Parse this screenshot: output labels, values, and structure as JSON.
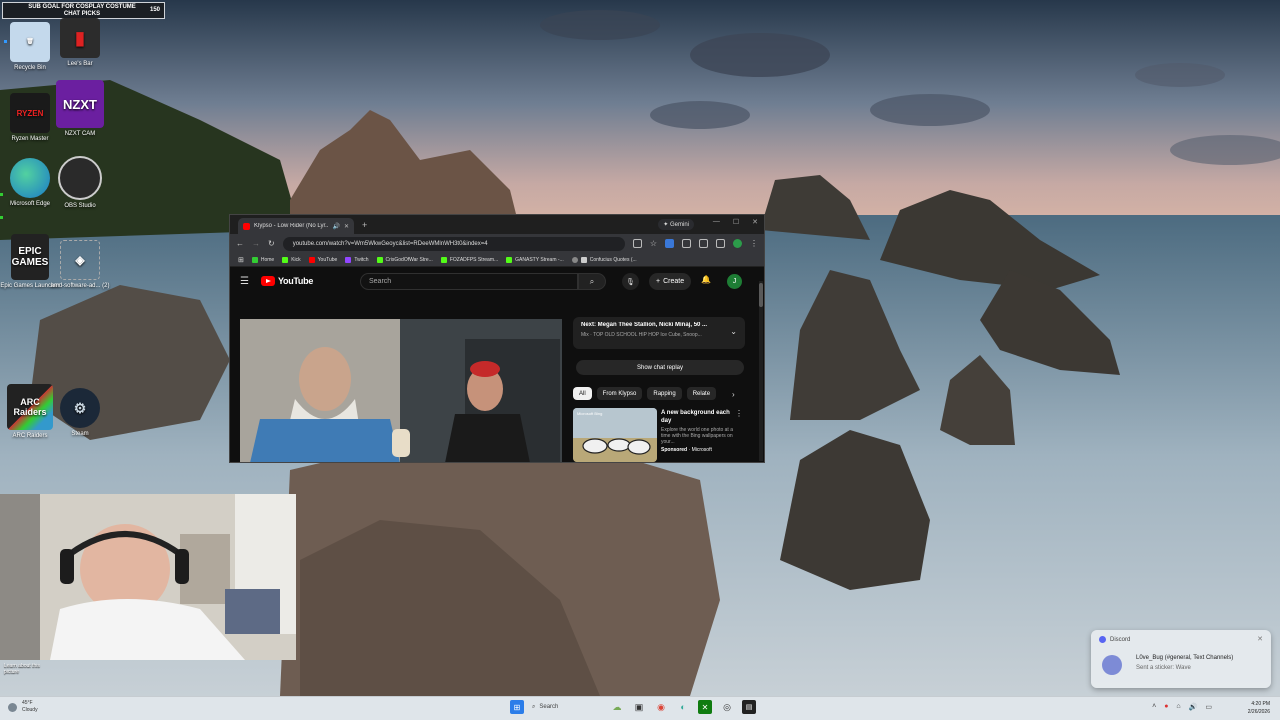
{
  "overlay": {
    "sub_goal_line1": "SUB GOAL FOR COSPLAY COSTUME",
    "sub_goal_line2": "CHAT PICKS",
    "sub_goal_count": "150"
  },
  "desktop_icons": [
    {
      "label": "Recycle Bin",
      "name": "recycle-bin"
    },
    {
      "label": "Lee's Bar",
      "name": "lees-bar"
    },
    {
      "label": "Ryzen Master",
      "name": "ryzen-master"
    },
    {
      "label": "NZXT CAM",
      "name": "nzxt-cam"
    },
    {
      "label": "Microsoft Edge",
      "name": "microsoft-edge"
    },
    {
      "label": "OBS Studio",
      "name": "obs-studio"
    },
    {
      "label": "Epic Games Launcher",
      "name": "epic-games-launcher"
    },
    {
      "label": "amd-software-ad... (2)",
      "name": "amd-software"
    },
    {
      "label": "ARC Raiders",
      "name": "arc-raiders"
    },
    {
      "label": "Steam",
      "name": "steam"
    }
  ],
  "icon_tiles": {
    "epic": "EPIC\nGAMES",
    "nzxt": "NZXT",
    "arc": "ARC\nRaiders"
  },
  "browser": {
    "tab_title": "Klypso - Low Rider (No Lyr...",
    "gemini_label": "Gemini",
    "url": "youtube.com/watch?v=Wm5WkwGeoyc&list=RDeeWMlnWH3t0&index=4",
    "bookmarks": [
      "Home",
      "Kick",
      "YouTube",
      "Twitch",
      "CrisGodOfWar Stre...",
      "FOZADFPS Stream...",
      "GANASTY Stream -...",
      "Confucius Quotes (..."
    ]
  },
  "youtube": {
    "logo_text": "YouTube",
    "search_placeholder": "Search",
    "create_label": "Create",
    "avatar_letter": "J",
    "next_title": "Next: Megan Thee Stallion, Nicki Minaj, 50 ...",
    "next_sub": "Mix · TOP OLD SCHOOL HIP HOP Ice Cube, Snoop...",
    "show_chat_replay": "Show chat replay",
    "chips": [
      "All",
      "From Klypso",
      "Rapping",
      "Relate"
    ],
    "ad_badge": "Microsoft Bing",
    "ad_title": "A new background each day",
    "ad_desc": "Explore the world one photo at a time with the Bing wallpapers on your...",
    "ad_sponsored": "Sponsored",
    "ad_sponsor": "Microsoft"
  },
  "webcam": {
    "learn_more": "Learn about this picture"
  },
  "toast": {
    "app": "Discord",
    "line1": "L0ve_Bug (#general, Text Channels)",
    "line2": "Sent a sticker: Wave"
  },
  "taskbar": {
    "weather_temp": "45°F",
    "weather_desc": "Cloudy",
    "search_label": "Search",
    "time": "4:20 PM",
    "date": "2/26/2026"
  },
  "colors": {
    "youtube_red": "#ff0000",
    "discord": "#5865f2",
    "nzxt": "#6b1fa0",
    "steam": "#1b2838"
  }
}
